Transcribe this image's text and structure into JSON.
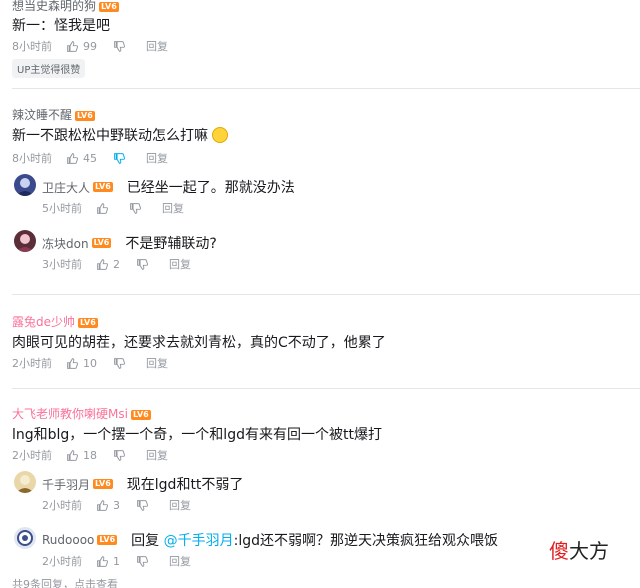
{
  "c1": {
    "user": "想当史森明的狗",
    "text": "新一：怪我是吧",
    "time": "8小时前",
    "likes": "99",
    "reply": "回复",
    "badge": "UP主觉得很赞"
  },
  "c2": {
    "user": "辣汶睡不醒",
    "text": "新一不跟松松中野联动怎么打嘛",
    "time": "8小时前",
    "likes": "45",
    "reply": "回复",
    "replies": [
      {
        "user": "卫庄大人",
        "text": "已经坐一起了。那就没办法",
        "time": "5小时前",
        "likes": "",
        "reply": "回复"
      },
      {
        "user": "冻块don",
        "text": "不是野辅联动?",
        "time": "3小时前",
        "likes": "2",
        "reply": "回复"
      }
    ]
  },
  "c3": {
    "user": "露兔de少帅",
    "text": "肉眼可见的胡茬，还要求去就刘青松，真的C不动了，他累了",
    "time": "2小时前",
    "likes": "10",
    "reply": "回复"
  },
  "c4": {
    "user": "大飞老师教你喇硬Msi",
    "text": "lng和blg，一个摆一个奇，一个和lgd有来有回一个被tt爆打",
    "time": "2小时前",
    "likes": "18",
    "reply": "回复",
    "replies": [
      {
        "user": "千手羽月",
        "text": "现在lgd和tt不弱了",
        "time": "2小时前",
        "likes": "3",
        "reply": "回复"
      },
      {
        "user": "Rudoooo",
        "prefix": "回复",
        "mention": "@千手羽月",
        "text": ":lgd还不弱啊？那逆天决策疯狂给观众喂饭",
        "time": "2小时前",
        "likes": "1",
        "reply": "回复"
      }
    ],
    "more": "共9条回复，点击查看"
  },
  "level_badge": "LV6",
  "watermark": {
    "red": "傻",
    "rest": "大方"
  },
  "colors": {
    "accent_blue": "#00aeec",
    "pink_name": "#fb7299",
    "meta_gray": "#9499a0"
  }
}
